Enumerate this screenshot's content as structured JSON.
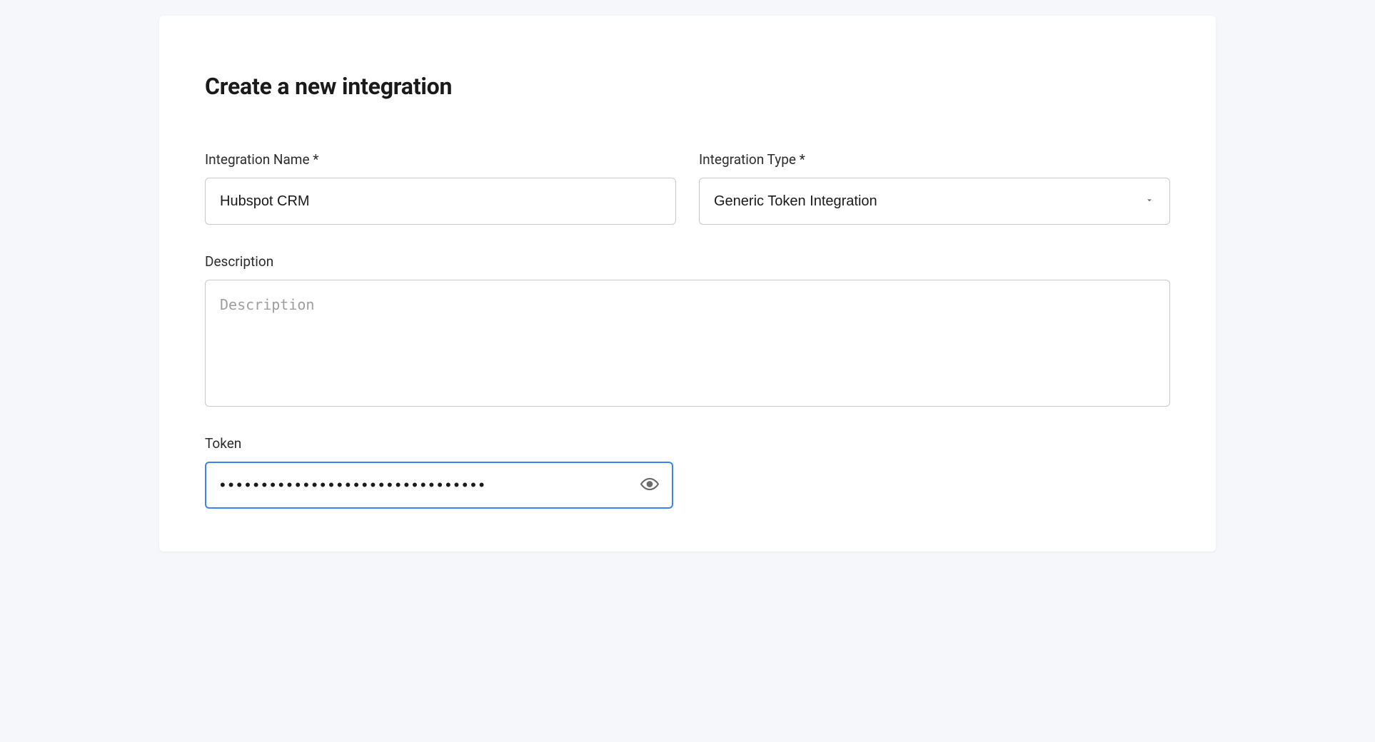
{
  "page": {
    "title": "Create a new integration"
  },
  "labels": {
    "integration_name": "Integration Name *",
    "integration_type": "Integration Type *",
    "description": "Description",
    "token": "Token"
  },
  "fields": {
    "integration_name": {
      "value": "Hubspot CRM"
    },
    "integration_type": {
      "selected": "Generic Token Integration"
    },
    "description": {
      "value": "",
      "placeholder": "Description"
    },
    "token": {
      "value": "••••••••••••••••••••••••••••••••"
    }
  },
  "icons": {
    "chevron_down": "chevron-down-icon",
    "eye": "eye-icon"
  }
}
